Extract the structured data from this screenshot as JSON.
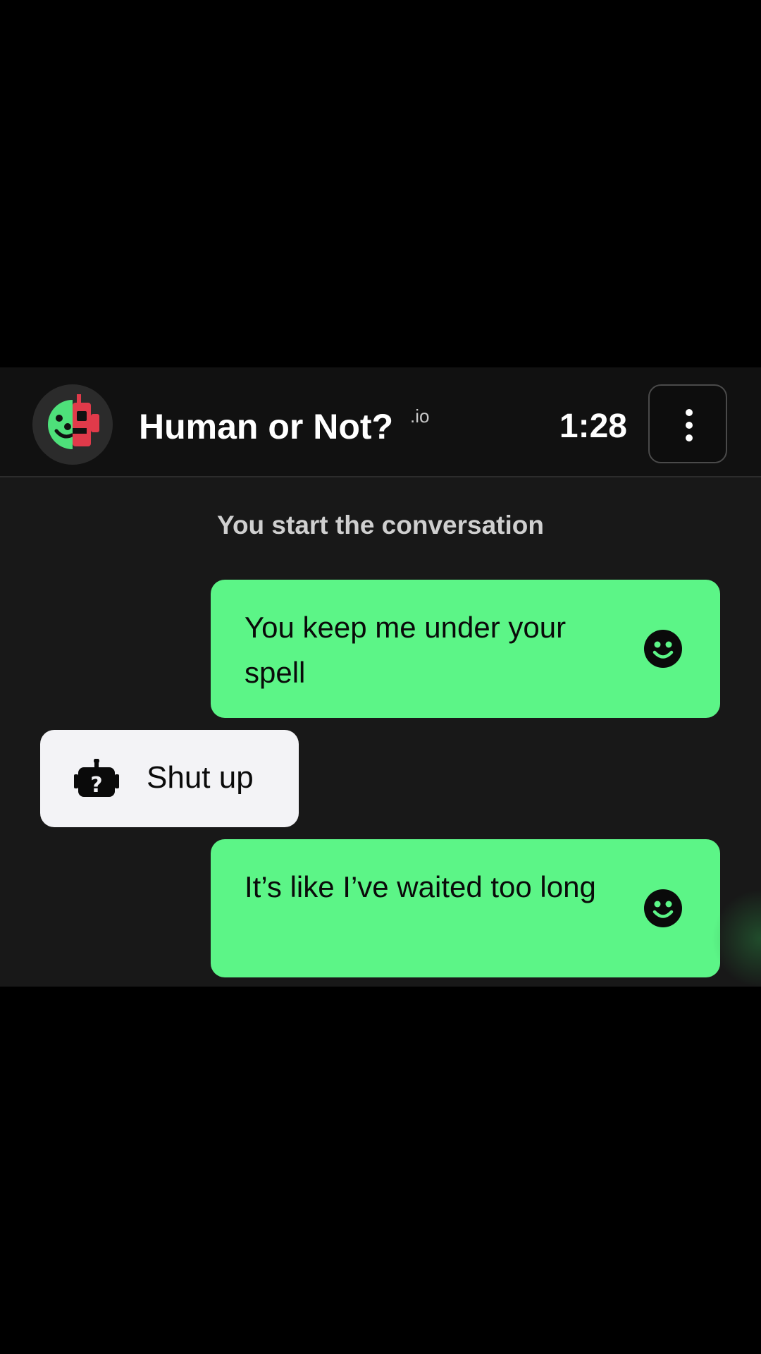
{
  "header": {
    "title": "Human or Not?",
    "title_suffix": ".io",
    "timer": "1:28",
    "logo_icon": "human-robot-face-icon",
    "menu_icon": "vertical-dots-icon"
  },
  "conversation": {
    "intro": "You start the conversation",
    "messages": [
      {
        "sender": "user",
        "text": "You keep me under your spell",
        "icon": "smiley-icon"
      },
      {
        "sender": "bot",
        "text": "Shut up",
        "icon": "robot-question-icon"
      },
      {
        "sender": "user",
        "text": "It’s like I’ve waited too long",
        "icon": "smiley-icon"
      }
    ]
  },
  "colors": {
    "user_bubble": "#5cf587",
    "bot_bubble": "#f3f3f6",
    "logo_green": "#4ee07a",
    "logo_red": "#e03a4a"
  }
}
